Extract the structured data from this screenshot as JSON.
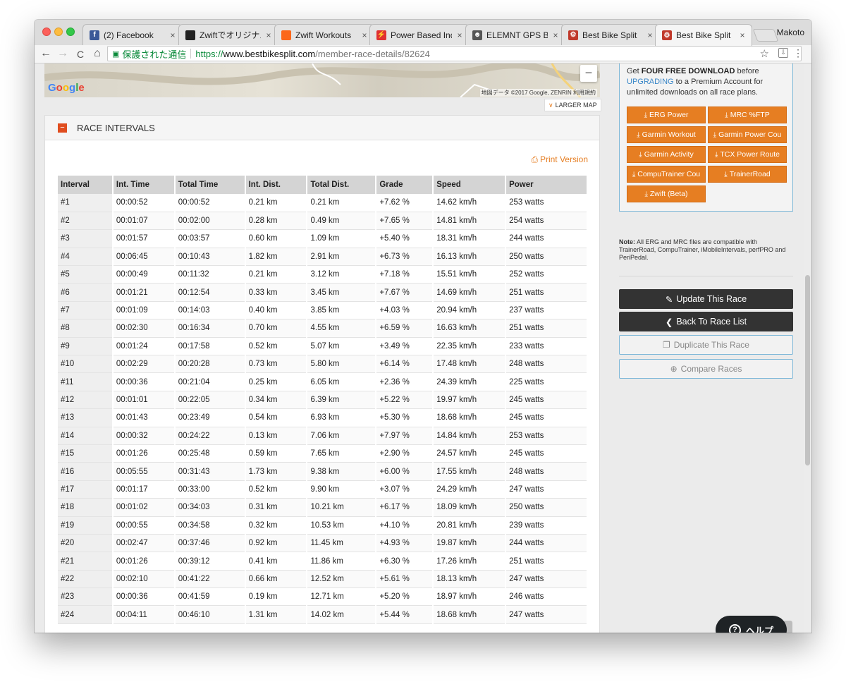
{
  "browser": {
    "profile_name": "Makoto",
    "tabs": [
      {
        "title": "(2) Facebook",
        "icon": "facebook-icon",
        "color": "#3b5998",
        "glyph": "f"
      },
      {
        "title": "Zwiftでオリジナル",
        "icon": "zwift-black-icon",
        "color": "#222222",
        "glyph": ""
      },
      {
        "title": "Zwift Workouts",
        "icon": "zwift-orange-icon",
        "color": "#fc6719",
        "glyph": ""
      },
      {
        "title": "Power Based Indo",
        "icon": "power-based-icon",
        "color": "#e03030",
        "glyph": "⚡"
      },
      {
        "title": "ELEMNT GPS Bik",
        "icon": "elemnt-icon",
        "color": "#555555",
        "glyph": "☻"
      },
      {
        "title": "Best Bike Split",
        "icon": "bestbikesplit-icon",
        "color": "#c0392b",
        "glyph": "⚙"
      },
      {
        "title": "Best Bike Split",
        "icon": "bestbikesplit-icon",
        "color": "#c0392b",
        "glyph": "⚙"
      }
    ],
    "tab_close": "×",
    "address": {
      "secure_label": "保護された通信",
      "scheme": "https://",
      "host": "www.bestbikesplit.com",
      "path": "/member-race-details/82624"
    },
    "nav": {
      "back": "←",
      "forward": "→",
      "reload": "C",
      "home": "⌂",
      "star": "☆",
      "menu": "⋮",
      "ext": "⇩",
      "lock": "🔒"
    }
  },
  "map": {
    "logo": "Google",
    "attribution": "地図データ ©2017 Google, ZENRIN   利用規約",
    "zoom_out": "−",
    "larger_map": "LARGER MAP",
    "chevron": "✔"
  },
  "race_intervals": {
    "title": "RACE INTERVALS",
    "collapse_symbol": "−",
    "print_version": "Print Version",
    "columns": [
      "Interval",
      "Int. Time",
      "Total Time",
      "Int. Dist.",
      "Total Dist.",
      "Grade",
      "Speed",
      "Power"
    ],
    "rows": [
      [
        "#1",
        "00:00:52",
        "00:00:52",
        "0.21 km",
        "0.21 km",
        "+7.62 %",
        "14.62 km/h",
        "253 watts"
      ],
      [
        "#2",
        "00:01:07",
        "00:02:00",
        "0.28 km",
        "0.49 km",
        "+7.65 %",
        "14.81 km/h",
        "254 watts"
      ],
      [
        "#3",
        "00:01:57",
        "00:03:57",
        "0.60 km",
        "1.09 km",
        "+5.40 %",
        "18.31 km/h",
        "244 watts"
      ],
      [
        "#4",
        "00:06:45",
        "00:10:43",
        "1.82 km",
        "2.91 km",
        "+6.73 %",
        "16.13 km/h",
        "250 watts"
      ],
      [
        "#5",
        "00:00:49",
        "00:11:32",
        "0.21 km",
        "3.12 km",
        "+7.18 %",
        "15.51 km/h",
        "252 watts"
      ],
      [
        "#6",
        "00:01:21",
        "00:12:54",
        "0.33 km",
        "3.45 km",
        "+7.67 %",
        "14.69 km/h",
        "251 watts"
      ],
      [
        "#7",
        "00:01:09",
        "00:14:03",
        "0.40 km",
        "3.85 km",
        "+4.03 %",
        "20.94 km/h",
        "237 watts"
      ],
      [
        "#8",
        "00:02:30",
        "00:16:34",
        "0.70 km",
        "4.55 km",
        "+6.59 %",
        "16.63 km/h",
        "251 watts"
      ],
      [
        "#9",
        "00:01:24",
        "00:17:58",
        "0.52 km",
        "5.07 km",
        "+3.49 %",
        "22.35 km/h",
        "233 watts"
      ],
      [
        "#10",
        "00:02:29",
        "00:20:28",
        "0.73 km",
        "5.80 km",
        "+6.14 %",
        "17.48 km/h",
        "248 watts"
      ],
      [
        "#11",
        "00:00:36",
        "00:21:04",
        "0.25 km",
        "6.05 km",
        "+2.36 %",
        "24.39 km/h",
        "225 watts"
      ],
      [
        "#12",
        "00:01:01",
        "00:22:05",
        "0.34 km",
        "6.39 km",
        "+5.22 %",
        "19.97 km/h",
        "245 watts"
      ],
      [
        "#13",
        "00:01:43",
        "00:23:49",
        "0.54 km",
        "6.93 km",
        "+5.30 %",
        "18.68 km/h",
        "245 watts"
      ],
      [
        "#14",
        "00:00:32",
        "00:24:22",
        "0.13 km",
        "7.06 km",
        "+7.97 %",
        "14.84 km/h",
        "253 watts"
      ],
      [
        "#15",
        "00:01:26",
        "00:25:48",
        "0.59 km",
        "7.65 km",
        "+2.90 %",
        "24.57 km/h",
        "245 watts"
      ],
      [
        "#16",
        "00:05:55",
        "00:31:43",
        "1.73 km",
        "9.38 km",
        "+6.00 %",
        "17.55 km/h",
        "248 watts"
      ],
      [
        "#17",
        "00:01:17",
        "00:33:00",
        "0.52 km",
        "9.90 km",
        "+3.07 %",
        "24.29 km/h",
        "247 watts"
      ],
      [
        "#18",
        "00:01:02",
        "00:34:03",
        "0.31 km",
        "10.21 km",
        "+6.17 %",
        "18.09 km/h",
        "250 watts"
      ],
      [
        "#19",
        "00:00:55",
        "00:34:58",
        "0.32 km",
        "10.53 km",
        "+4.10 %",
        "20.81 km/h",
        "239 watts"
      ],
      [
        "#20",
        "00:02:47",
        "00:37:46",
        "0.92 km",
        "11.45 km",
        "+4.93 %",
        "19.87 km/h",
        "244 watts"
      ],
      [
        "#21",
        "00:01:26",
        "00:39:12",
        "0.41 km",
        "11.86 km",
        "+6.30 %",
        "17.26 km/h",
        "251 watts"
      ],
      [
        "#22",
        "00:02:10",
        "00:41:22",
        "0.66 km",
        "12.52 km",
        "+5.61 %",
        "18.13 km/h",
        "247 watts"
      ],
      [
        "#23",
        "00:00:36",
        "00:41:59",
        "0.19 km",
        "12.71 km",
        "+5.20 %",
        "18.97 km/h",
        "246 watts"
      ],
      [
        "#24",
        "00:04:11",
        "00:46:10",
        "1.31 km",
        "14.02 km",
        "+5.44 %",
        "18.68 km/h",
        "247 watts"
      ]
    ]
  },
  "sidebar": {
    "download_text": {
      "get": "Get ",
      "bold": "FOUR FREE DOWNLOAD",
      "before": " before",
      "upgrading": "UPGRADING",
      "rest": " to a Premium Account for unlimited downloads on all race plans."
    },
    "download_buttons": [
      {
        "label": "ERG Power",
        "name": "erg-power-button"
      },
      {
        "label": "MRC %FTP",
        "name": "mrc-ftp-button"
      },
      {
        "label": "Garmin Workout",
        "name": "garmin-workout-button"
      },
      {
        "label": "Garmin Power Cou",
        "name": "garmin-power-course-button"
      },
      {
        "label": "Garmin Activity",
        "name": "garmin-activity-button"
      },
      {
        "label": "TCX Power Route",
        "name": "tcx-power-route-button"
      },
      {
        "label": "CompuTrainer Cou",
        "name": "computrainer-course-button"
      },
      {
        "label": "TrainerRoad",
        "name": "trainerroad-button"
      },
      {
        "label": "Zwift (Beta)",
        "name": "zwift-beta-button"
      }
    ],
    "note_label": "Note:",
    "note_text": " All ERG and MRC files are compatible with TrainerRoad, CompuTrainer, iMobileIntervals, perfPRO and PeriPedal.",
    "actions": {
      "update": "Update This Race",
      "back": "Back To Race List",
      "duplicate": "Duplicate This Race",
      "compare": "Compare Races"
    }
  },
  "help_widget": {
    "label": "ヘルプ",
    "symbol": "?"
  },
  "colors": {
    "accent_orange": "#e67e22",
    "dark_button": "#333333",
    "link_blue": "#3a87c8",
    "secure_green": "#0a8a3a"
  }
}
